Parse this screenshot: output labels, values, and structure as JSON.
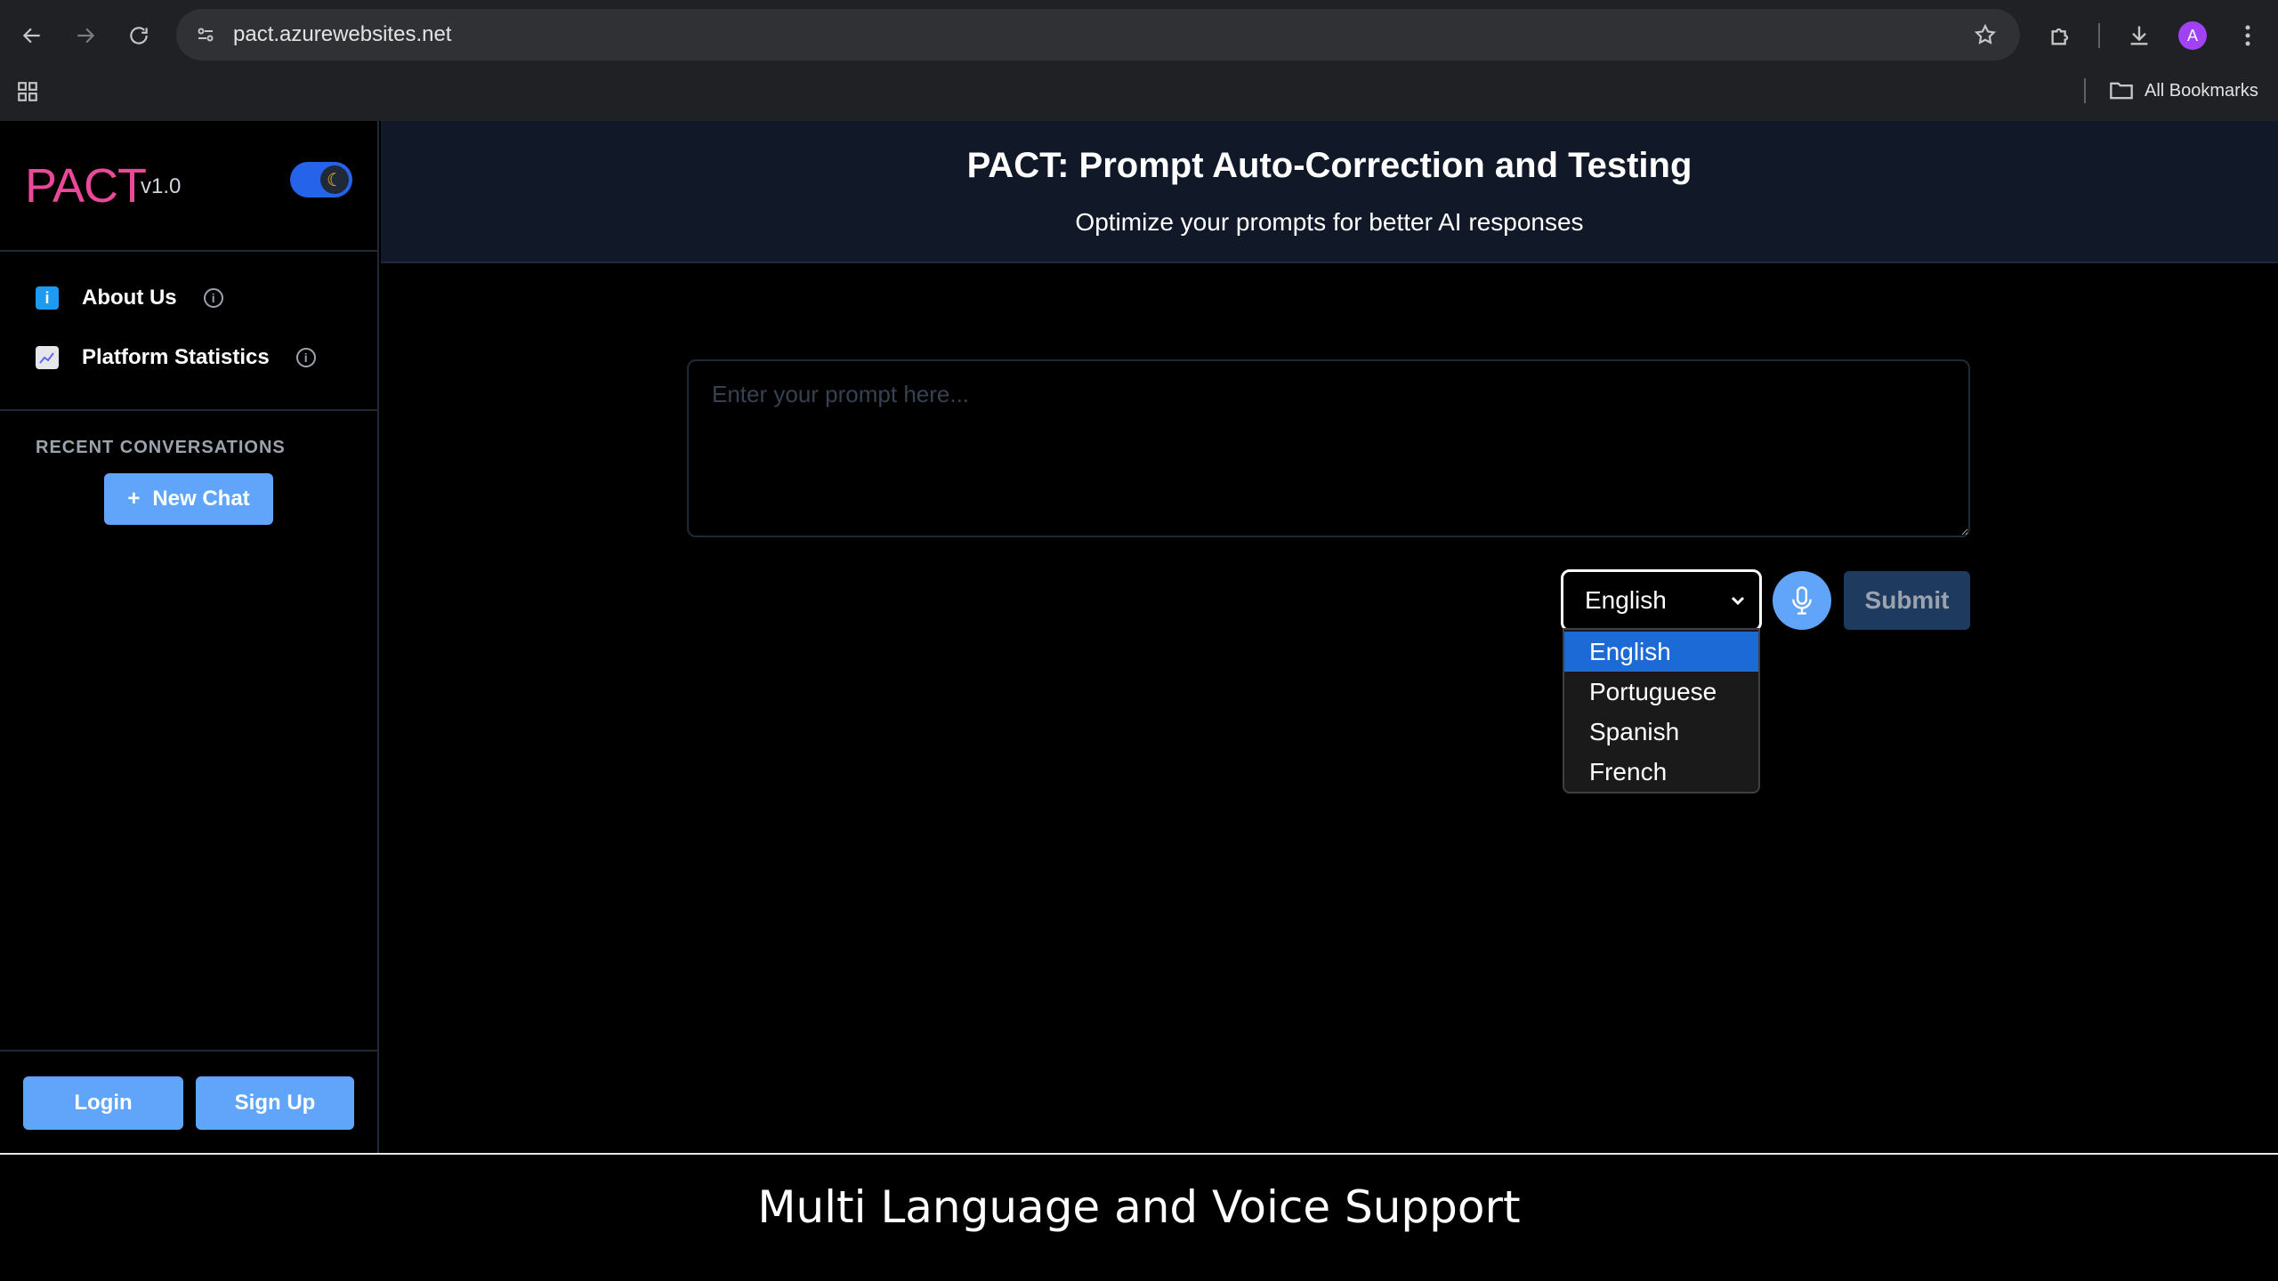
{
  "browser": {
    "url": "pact.azurewebsites.net",
    "avatar_letter": "A",
    "all_bookmarks": "All Bookmarks"
  },
  "brand": {
    "logo": "PACT",
    "version": "v1.0",
    "toggle_icon": "moon-icon"
  },
  "menu": {
    "items": [
      {
        "label": "About Us",
        "icon": "info-square-icon"
      },
      {
        "label": "Platform Statistics",
        "icon": "chart-icon"
      }
    ]
  },
  "recent": {
    "title": "RECENT CONVERSATIONS",
    "new_chat_label": "New Chat"
  },
  "auth": {
    "login_label": "Login",
    "signup_label": "Sign Up"
  },
  "header": {
    "title": "PACT: Prompt Auto-Correction and Testing",
    "subtitle": "Optimize your prompts for better AI responses"
  },
  "prompt": {
    "placeholder": "Enter your prompt here...",
    "value": ""
  },
  "language": {
    "selected": "English",
    "options": [
      "English",
      "Portuguese",
      "Spanish",
      "French"
    ]
  },
  "submit_label": "Submit",
  "caption": "Multi Language and Voice Support",
  "colors": {
    "accent": "#60a5fa",
    "logo": "#ec4899",
    "header_bg": "#111827",
    "selected_option": "#1c6ad6"
  }
}
